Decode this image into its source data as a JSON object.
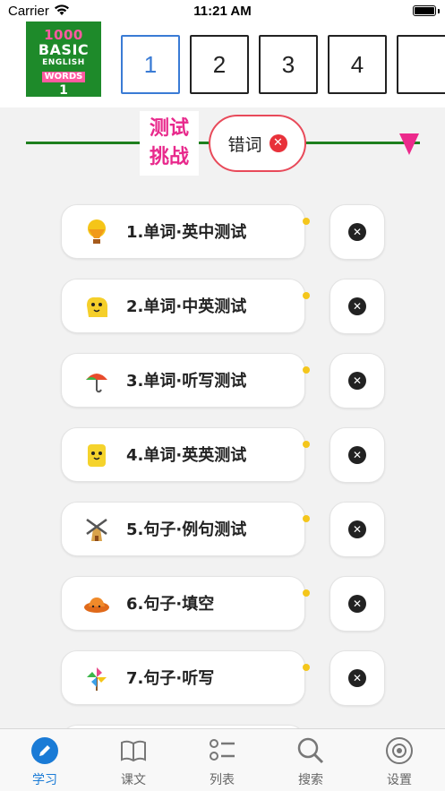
{
  "status_bar": {
    "carrier": "Carrier",
    "time": "11:21 AM"
  },
  "logo": {
    "line1": "1000",
    "line2": "BASIC",
    "line3": "ENGLISH",
    "line4": "WORDS",
    "line5": "1"
  },
  "lessons": [
    "1",
    "2",
    "3",
    "4"
  ],
  "active_lesson": "1",
  "filter": {
    "test_challenge": "测试\n挑战",
    "tc_line1": "测试",
    "tc_line2": "挑战",
    "wrong_words": "错词"
  },
  "tests": [
    {
      "label": "1.单词·英中测试",
      "icon": "hot-air-balloon-icon"
    },
    {
      "label": "2.单词·中英测试",
      "icon": "yellow-creature-icon"
    },
    {
      "label": "3.单词·听写测试",
      "icon": "umbrella-icon"
    },
    {
      "label": "4.单词·英英测试",
      "icon": "yellow-block-icon"
    },
    {
      "label": "5.句子·例句测试",
      "icon": "windmill-icon"
    },
    {
      "label": "6.句子·填空",
      "icon": "hat-icon"
    },
    {
      "label": "7.句子·听写",
      "icon": "pinwheel-icon"
    }
  ],
  "tabs": [
    {
      "label": "学习",
      "icon": "pencil-icon",
      "active": true
    },
    {
      "label": "课文",
      "icon": "book-icon",
      "active": false
    },
    {
      "label": "列表",
      "icon": "list-icon",
      "active": false
    },
    {
      "label": "搜索",
      "icon": "search-icon",
      "active": false
    },
    {
      "label": "设置",
      "icon": "gear-icon",
      "active": false
    }
  ],
  "colors": {
    "accent": "#1a7bd6",
    "pink": "#e8298c",
    "green": "#1e8a2a",
    "dot": "#f4c61c"
  }
}
